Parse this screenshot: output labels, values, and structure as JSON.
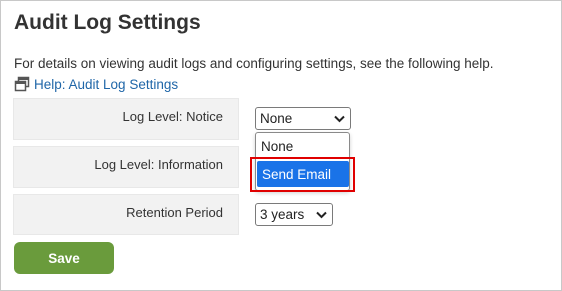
{
  "page": {
    "title": "Audit Log Settings",
    "help_text": "For details on viewing audit logs and configuring settings, see the following help.",
    "help_link": {
      "label": "Help: Audit Log Settings",
      "icon": "window-restore-icon"
    }
  },
  "settings": {
    "rows": [
      {
        "label": "Log Level: Notice",
        "value": "None"
      },
      {
        "label": "Log Level: Information",
        "value": ""
      },
      {
        "label": "Retention Period",
        "value": "3 years"
      }
    ]
  },
  "dropdown": {
    "options": [
      "None",
      "Send Email"
    ],
    "highlighted": "Send Email"
  },
  "actions": {
    "save_label": "Save"
  },
  "colors": {
    "link": "#1f66a8",
    "selected_option": "#1a73e8",
    "save_button": "#6a9b3c",
    "highlight_box": "#e00000",
    "row_background": "#f2f2f2"
  }
}
